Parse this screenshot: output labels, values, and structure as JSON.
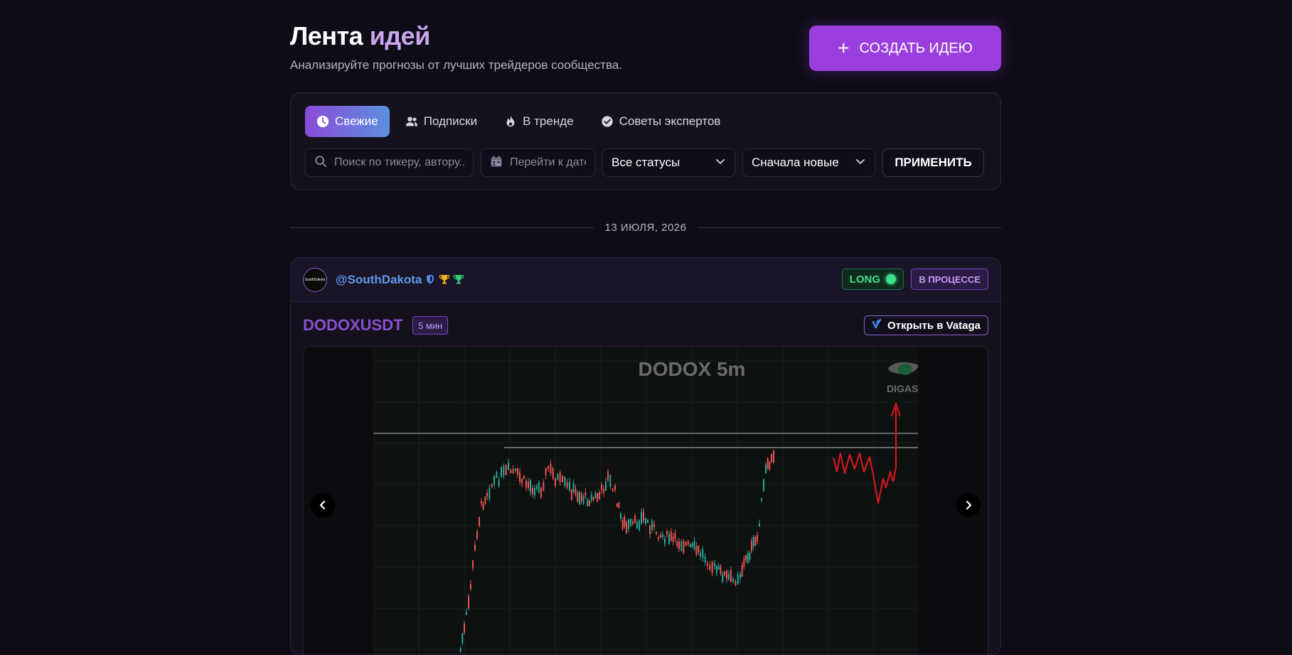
{
  "header": {
    "title_part1": "Лента ",
    "title_part2": "идей",
    "subtitle": "Анализируйте прогнозы от лучших трейдеров сообщества.",
    "create_button": "СОЗДАТЬ ИДЕЮ"
  },
  "tabs": [
    {
      "label": "Свежие",
      "icon": "clock-icon",
      "active": true
    },
    {
      "label": "Подписки",
      "icon": "users-icon",
      "active": false
    },
    {
      "label": "В тренде",
      "icon": "fire-icon",
      "active": false
    },
    {
      "label": "Советы экспертов",
      "icon": "verified-icon",
      "active": false
    }
  ],
  "filters": {
    "search_placeholder": "Поиск по тикеру, автору...",
    "date_placeholder": "Перейти к дате",
    "status_value": "Все статусы",
    "sort_value": "Сначала новые",
    "apply_label": "ПРИМЕНИТЬ"
  },
  "feed": {
    "date_label": "13 ИЮЛЯ, 2026"
  },
  "idea": {
    "author": "@SouthDakota",
    "avatar_text": "SouthDakota",
    "direction": "LONG",
    "status": "В ПРОЦЕССЕ",
    "ticker": "DODOXUSDT",
    "timeframe": "5 мин",
    "open_label": "Открыть в Vataga",
    "chart_title": "DODOX 5m",
    "watermark": "DIGASH"
  },
  "colors": {
    "accent": "#9a3fdd",
    "long": "#3ee08a",
    "candle_up": "#26a69a",
    "candle_down": "#ef5350",
    "forecast": "#e0181f"
  }
}
